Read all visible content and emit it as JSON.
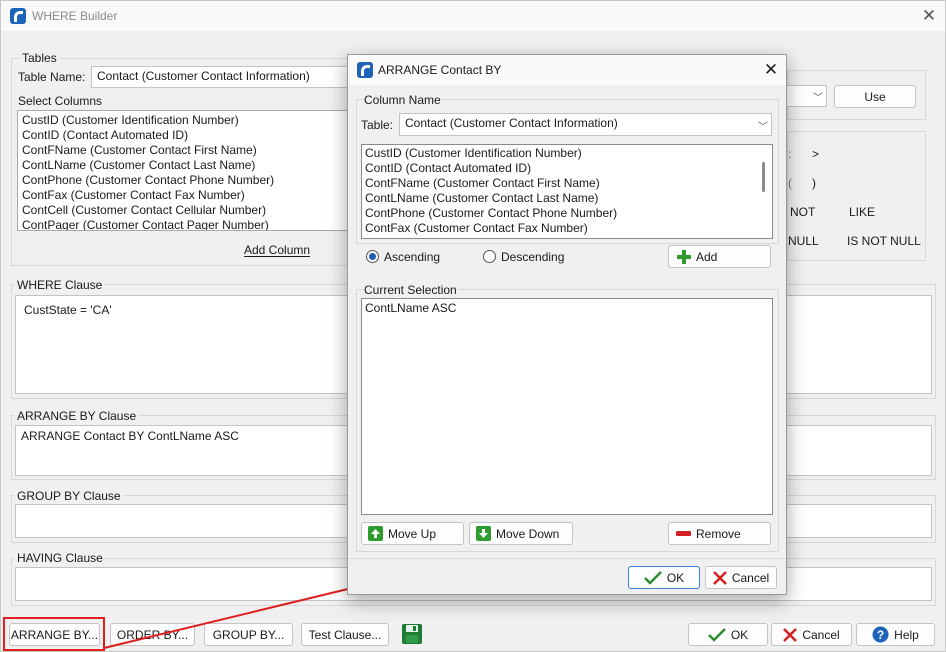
{
  "main": {
    "title": "WHERE Builder",
    "close": "✕",
    "tables_group": "Tables",
    "table_name_label": "Table Name:",
    "table_name_value": "Contact  (Customer Contact Information)",
    "select_columns_label": "Select Columns",
    "columns": [
      "CustID  (Customer Identification Number)",
      "ContID  (Contact Automated ID)",
      "ContFName  (Customer Contact First Name)",
      "ContLName  (Customer Contact Last Name)",
      "ContPhone  (Customer Contact Phone Number)",
      "ContFax  (Customer Contact Fax Number)",
      "ContCell  (Customer Contact Cellular Number)",
      "ContPager  (Customer Contact Pager Number)"
    ],
    "add_column": "Add Column",
    "use_button": "Use",
    "operators": [
      ">",
      ")",
      "NOT",
      "LIKE",
      "NULL",
      "IS NOT NULL"
    ],
    "where_group": "WHERE Clause",
    "where_text": "CustState  =  'CA'",
    "arrange_group": "ARRANGE BY Clause",
    "arrange_text": "ARRANGE Contact BY ContLName ASC",
    "group_by_group": "GROUP BY Clause",
    "having_group": "HAVING Clause",
    "footer": {
      "arrange_by": "ARRANGE BY...",
      "order_by": "ORDER BY...",
      "group_by": "GROUP BY...",
      "test_clause": "Test Clause...",
      "ok": "OK",
      "cancel": "Cancel",
      "help": "Help"
    }
  },
  "dialog": {
    "title": "ARRANGE Contact BY",
    "close": "✕",
    "column_name_group": "Column Name",
    "table_label": "Table:",
    "table_value": "Contact  (Customer Contact Information)",
    "columns": [
      "CustID  (Customer Identification Number)",
      "ContID  (Contact Automated ID)",
      "ContFName  (Customer Contact First Name)",
      "ContLName  (Customer Contact Last Name)",
      "ContPhone  (Customer Contact Phone Number)",
      "ContFax  (Customer Contact Fax Number)"
    ],
    "ascending": "Ascending",
    "descending": "Descending",
    "sort_selected": "Ascending",
    "add": "Add",
    "current_selection_group": "Current Selection",
    "current_selection": [
      "ContLName ASC"
    ],
    "move_up": "Move Up",
    "move_down": "Move Down",
    "remove": "Remove",
    "ok": "OK",
    "cancel": "Cancel"
  },
  "colors": {
    "accent": "#1d63b8",
    "highlight": "#e02020",
    "ok_check": "#2e8b2e",
    "cancel_x": "#d42020",
    "add_plus": "#2e9b2e"
  }
}
